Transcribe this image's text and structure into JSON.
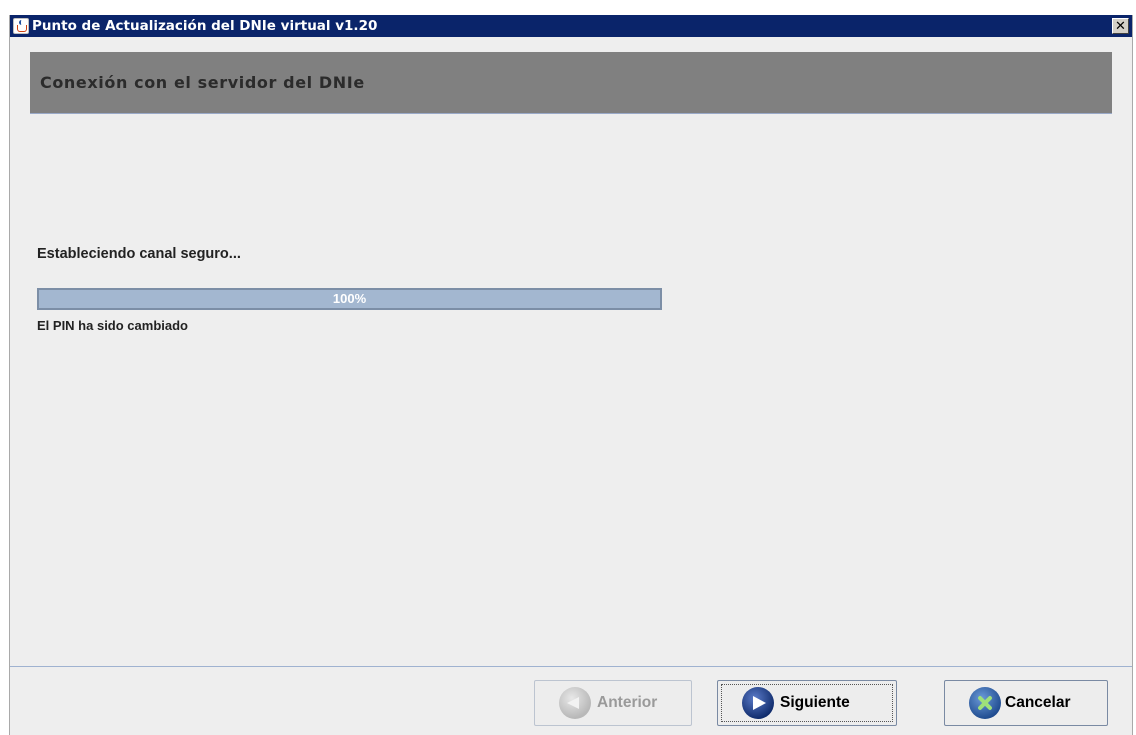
{
  "window": {
    "title": "Punto de Actualización del DNIe virtual v1.20",
    "close_glyph": "✕",
    "icon": "java-cup-icon"
  },
  "header": {
    "title": "Conexión con el servidor del DNIe"
  },
  "main": {
    "status_text": "Estableciendo canal seguro...",
    "progress": {
      "percent": 100,
      "label": "100%"
    },
    "result_text": "El PIN ha sido cambiado"
  },
  "footer": {
    "buttons": {
      "previous": {
        "label": "Anterior",
        "icon": "arrow-left-icon",
        "enabled": false
      },
      "next": {
        "label": "Siguiente",
        "icon": "arrow-right-icon",
        "enabled": true,
        "focused": true
      },
      "cancel": {
        "label": "Cancelar",
        "icon": "cancel-x-icon",
        "enabled": true
      }
    }
  },
  "colors": {
    "titlebar": "#0a246a",
    "header_band": "#808080",
    "progress_fill": "#a3b7d0",
    "background": "#eeeeee"
  }
}
